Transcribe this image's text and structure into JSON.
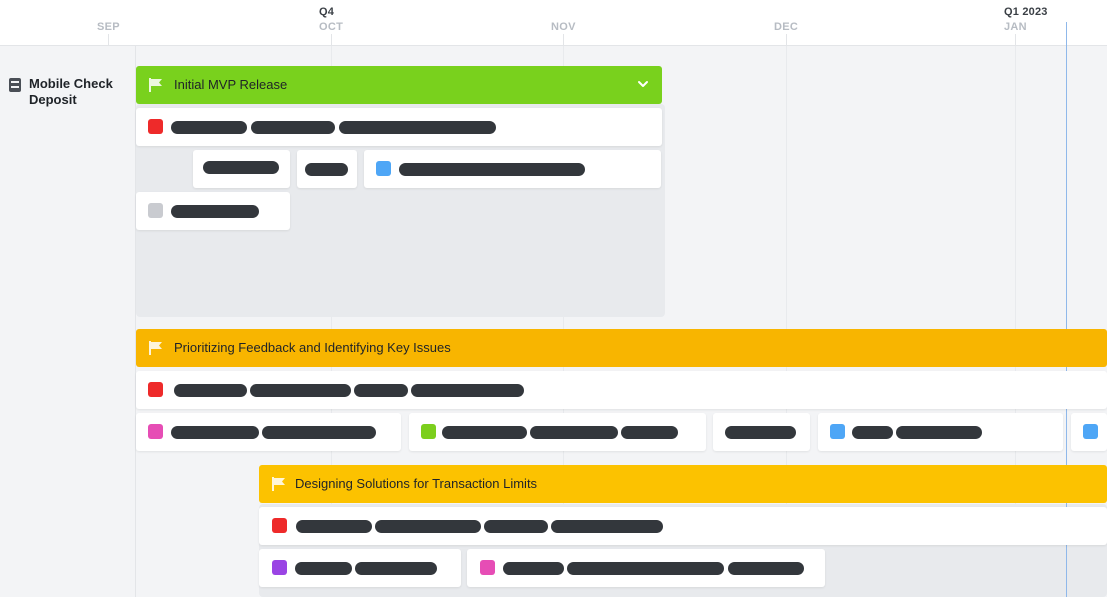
{
  "timeline": {
    "quarters": [
      {
        "label": "Q4"
      },
      {
        "label": "Q1 2023"
      }
    ],
    "months": [
      {
        "label": "SEP"
      },
      {
        "label": "OCT"
      },
      {
        "label": "NOV"
      },
      {
        "label": "DEC"
      },
      {
        "label": "JAN"
      }
    ]
  },
  "project": {
    "name": "Mobile Check Deposit",
    "icon": "project-icon"
  },
  "milestones": [
    {
      "title": "Initial MVP Release",
      "color": "#79d11d",
      "icon": "flag-icon",
      "collapsed_indicator": "chevron-down-icon"
    },
    {
      "title": "Prioritizing Feedback and Identifying Key Issues",
      "color": "#f8b500",
      "icon": "flag-icon"
    },
    {
      "title": "Designing Solutions for Transaction Limits",
      "color": "#fcc200",
      "icon": "flag-icon"
    }
  ],
  "status_colors": {
    "red": "#ee2a2a",
    "blue": "#4ea6f6",
    "gray": "#c9cbd0",
    "pink": "#e64db5",
    "green": "#7ccf1d",
    "purple": "#9a44e4"
  }
}
